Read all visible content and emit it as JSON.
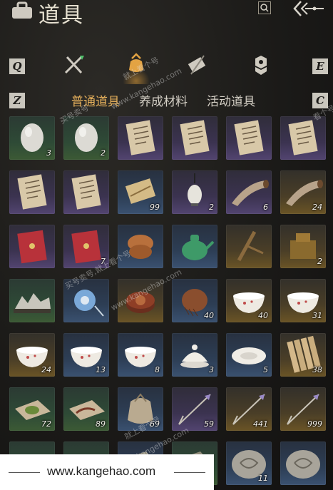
{
  "header": {
    "title": "道具"
  },
  "hotkeys": {
    "prev_category": "Q",
    "next_category": "E",
    "prev_subtab": "Z",
    "next_subtab": "C"
  },
  "category_tabs": [
    {
      "name": "weapons",
      "icon": "crossed-swords-icon",
      "active": false
    },
    {
      "name": "items",
      "icon": "pouch-icon",
      "active": true
    },
    {
      "name": "scrolls",
      "icon": "scroll-icon",
      "active": false
    },
    {
      "name": "insignia",
      "icon": "badge-icon",
      "active": false
    }
  ],
  "subtabs": [
    {
      "label": "普通道具",
      "active": true
    },
    {
      "label": "养成材料",
      "active": false
    },
    {
      "label": "活动道具",
      "active": false
    }
  ],
  "colors": {
    "accent": "#e7b15c",
    "hotkey_bg": "#c9c6bd"
  },
  "items": [
    {
      "icon": "egg-icon",
      "qty": "3",
      "quality": "green"
    },
    {
      "icon": "egg-icon",
      "qty": "2",
      "quality": "green"
    },
    {
      "icon": "letter-icon",
      "qty": "",
      "quality": "purple"
    },
    {
      "icon": "letter-icon",
      "qty": "",
      "quality": "purple"
    },
    {
      "icon": "letter-icon",
      "qty": "",
      "quality": "purple"
    },
    {
      "icon": "letter-icon",
      "qty": "",
      "quality": "purple"
    },
    {
      "icon": "letter-icon",
      "qty": "",
      "quality": "purple"
    },
    {
      "icon": "letter-icon",
      "qty": "",
      "quality": "purple"
    },
    {
      "icon": "book-icon",
      "qty": "99",
      "quality": "blue"
    },
    {
      "icon": "lantern-icon",
      "qty": "2",
      "quality": "purple"
    },
    {
      "icon": "horn-icon",
      "qty": "6",
      "quality": "purple"
    },
    {
      "icon": "horn-icon",
      "qty": "24",
      "quality": "gold"
    },
    {
      "icon": "red-envelope-icon",
      "qty": "",
      "quality": "purple"
    },
    {
      "icon": "red-envelope-icon",
      "qty": "7",
      "quality": "purple"
    },
    {
      "icon": "biscuit-icon",
      "qty": "",
      "quality": "blue"
    },
    {
      "icon": "teapot-icon",
      "qty": "",
      "quality": "blue"
    },
    {
      "icon": "tool-icon",
      "qty": "",
      "quality": "gold"
    },
    {
      "icon": "seal-box-icon",
      "qty": "2",
      "quality": "gold"
    },
    {
      "icon": "rock-display-icon",
      "qty": "",
      "quality": "green"
    },
    {
      "icon": "jade-ornament-icon",
      "qty": "",
      "quality": "blue"
    },
    {
      "icon": "lacquer-box-icon",
      "qty": "",
      "quality": "gold"
    },
    {
      "icon": "comb-icon",
      "qty": "40",
      "quality": "blue"
    },
    {
      "icon": "bowl-icon",
      "qty": "40",
      "quality": "gold"
    },
    {
      "icon": "bowl-icon",
      "qty": "31",
      "quality": "gold"
    },
    {
      "icon": "bowl-icon",
      "qty": "24",
      "quality": "gold"
    },
    {
      "icon": "bowl-icon",
      "qty": "13",
      "quality": "blue"
    },
    {
      "icon": "bowl-icon",
      "qty": "8",
      "quality": "blue"
    },
    {
      "icon": "covered-bowl-icon",
      "qty": "3",
      "quality": "blue"
    },
    {
      "icon": "dish-icon",
      "qty": "5",
      "quality": "blue"
    },
    {
      "icon": "bamboo-slip-icon",
      "qty": "38",
      "quality": "gold"
    },
    {
      "icon": "tea-leaves-icon",
      "qty": "72",
      "quality": "green"
    },
    {
      "icon": "herb-icon",
      "qty": "89",
      "quality": "green"
    },
    {
      "icon": "sack-icon",
      "qty": "69",
      "quality": "blue"
    },
    {
      "icon": "arrow-icon",
      "qty": "59",
      "quality": "purple"
    },
    {
      "icon": "arrow-icon",
      "qty": "441",
      "quality": "gold"
    },
    {
      "icon": "arrow-icon",
      "qty": "999",
      "quality": "gold"
    },
    {
      "icon": "plant-icon",
      "qty": "",
      "quality": "green"
    },
    {
      "icon": "plant-icon",
      "qty": "",
      "quality": "green"
    },
    {
      "icon": "ore-icon",
      "qty": "",
      "quality": "blue"
    },
    {
      "icon": "ore-icon",
      "qty": "",
      "quality": "green"
    },
    {
      "icon": "fossil-icon",
      "qty": "11",
      "quality": "blue"
    },
    {
      "icon": "fossil-icon",
      "qty": "",
      "quality": "blue"
    }
  ],
  "watermark": {
    "url": "www.kangehao.com",
    "stamps": [
      "就上看个号",
      "www.kangehao.com",
      "买号卖号",
      "看个号",
      "买号卖号,就上看个号",
      "www.kangehao.com",
      "就上看个号",
      "www.kangehao.com"
    ]
  }
}
